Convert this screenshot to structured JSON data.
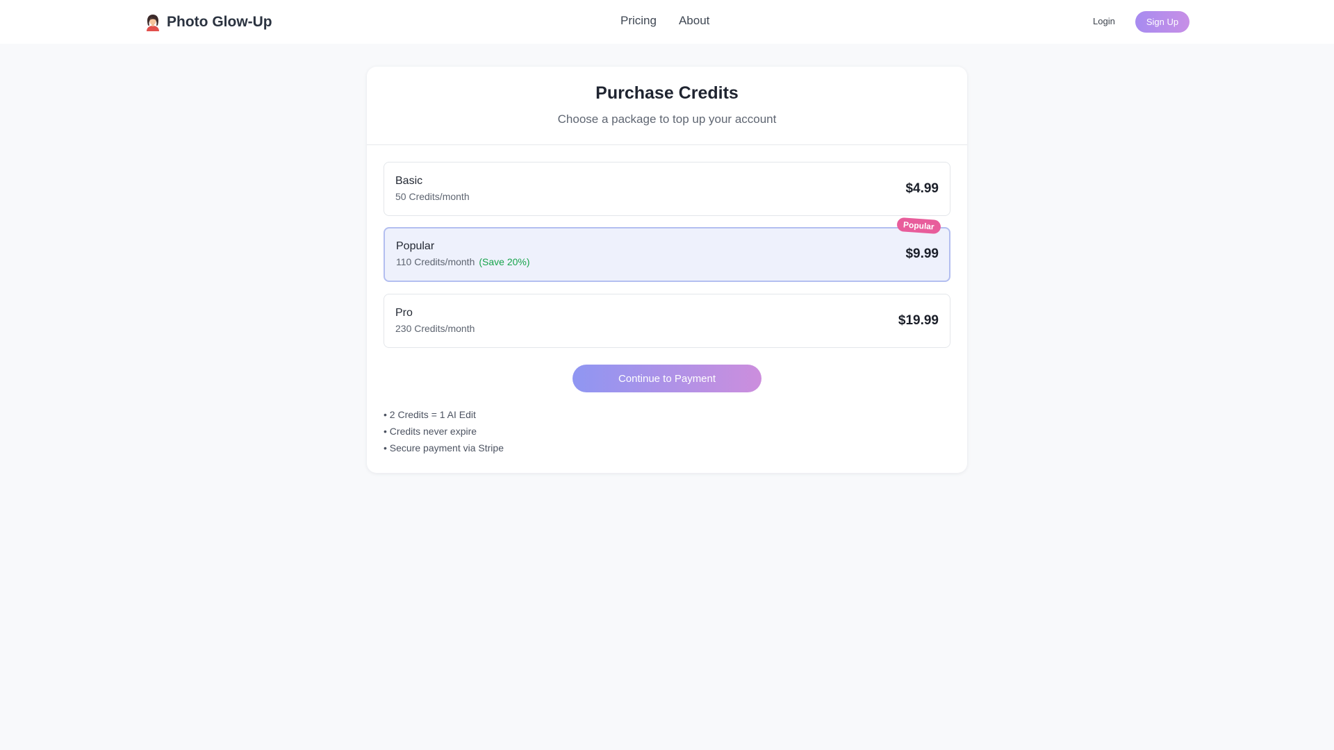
{
  "header": {
    "brand": "Photo Glow-Up",
    "brand_icon": "woman-icon",
    "nav": [
      "Pricing",
      "About"
    ],
    "login_label": "Login",
    "signup_label": "Sign Up"
  },
  "card": {
    "title": "Purchase Credits",
    "subtitle": "Choose a package to top up your account",
    "plans": [
      {
        "name": "Basic",
        "credits": "50 Credits/month",
        "price": "$4.99",
        "selected": false
      },
      {
        "name": "Popular",
        "credits": "110 Credits/month",
        "save": "(Save 20%)",
        "price": "$9.99",
        "badge": "Popular",
        "selected": true
      },
      {
        "name": "Pro",
        "credits": "230 Credits/month",
        "price": "$19.99",
        "selected": false
      }
    ],
    "continue_label": "Continue to Payment",
    "notes": [
      "• 2 Credits = 1 AI Edit",
      "• Credits never expire",
      "• Secure payment via Stripe"
    ]
  },
  "colors": {
    "accent_purple": "#a78bf0",
    "save_green": "#16a34a",
    "badge_pink": "#e85d9b",
    "selected_bg": "#eef1fc"
  }
}
